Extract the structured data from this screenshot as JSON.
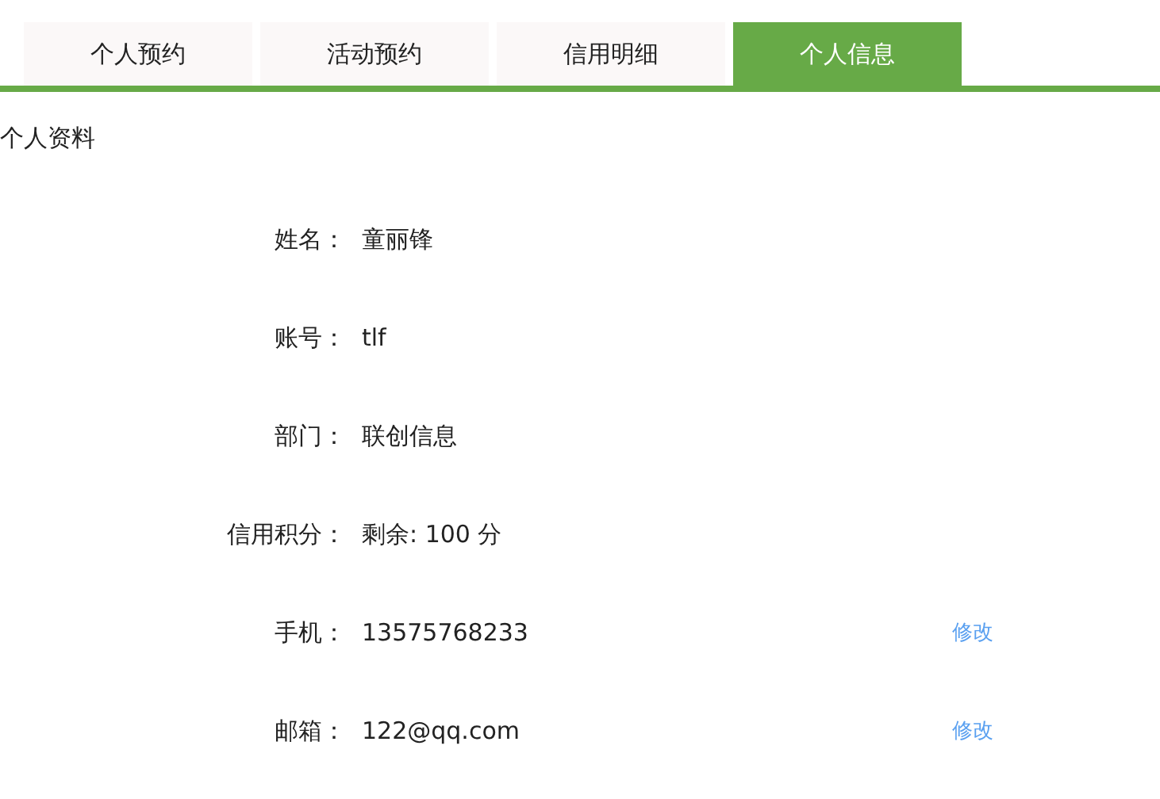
{
  "tabs": [
    {
      "label": "个人预约",
      "selected": false
    },
    {
      "label": "活动预约",
      "selected": false
    },
    {
      "label": "信用明细",
      "selected": false
    },
    {
      "label": "个人信息",
      "selected": true
    }
  ],
  "section_title": "个人资料",
  "fields": [
    {
      "label": "姓名：",
      "value": "童丽锋"
    },
    {
      "label": "账号：",
      "value": "tlf"
    },
    {
      "label": "部门：",
      "value": "联创信息"
    },
    {
      "label": "信用积分：",
      "value": "剩余: 100 分"
    },
    {
      "label": "手机：",
      "value": "13575768233",
      "action": "修改"
    },
    {
      "label": "邮箱：",
      "value": "122@qq.com",
      "action": "修改"
    }
  ]
}
